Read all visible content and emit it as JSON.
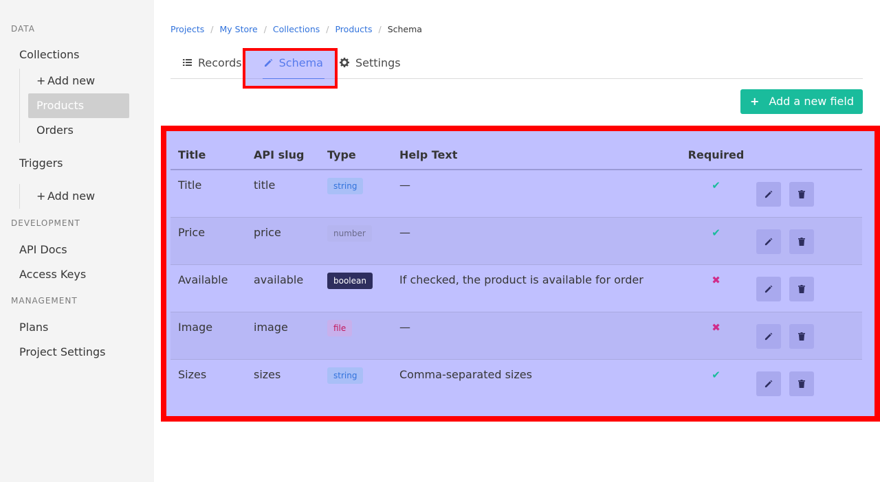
{
  "sidebar": {
    "sections": [
      {
        "label": "DATA"
      },
      {
        "label": "DEVELOPMENT"
      },
      {
        "label": "MANAGEMENT"
      }
    ],
    "collections_label": "Collections",
    "collections_add": "Add new",
    "collections_items": [
      "Products",
      "Orders"
    ],
    "triggers_label": "Triggers",
    "triggers_add": "Add new",
    "dev_items": [
      "API Docs",
      "Access Keys"
    ],
    "mgmt_items": [
      "Plans",
      "Project Settings"
    ]
  },
  "breadcrumb": [
    "Projects",
    "My Store",
    "Collections",
    "Products",
    "Schema"
  ],
  "tabs": [
    {
      "label": "Records",
      "icon": "list-icon"
    },
    {
      "label": "Schema",
      "icon": "pencil-icon",
      "active": true
    },
    {
      "label": "Settings",
      "icon": "gear-icon"
    }
  ],
  "toolbar": {
    "add_field_label": "Add a new field"
  },
  "table": {
    "headers": [
      "Title",
      "API slug",
      "Type",
      "Help Text",
      "Required"
    ],
    "rows": [
      {
        "title": "Title",
        "slug": "title",
        "type": "string",
        "help": "—",
        "required": true
      },
      {
        "title": "Price",
        "slug": "price",
        "type": "number",
        "help": "—",
        "required": true
      },
      {
        "title": "Available",
        "slug": "available",
        "type": "boolean",
        "help": "If checked, the product is available for order",
        "required": false
      },
      {
        "title": "Image",
        "slug": "image",
        "type": "file",
        "help": "—",
        "required": false
      },
      {
        "title": "Sizes",
        "slug": "sizes",
        "type": "string",
        "help": "Comma-separated sizes",
        "required": true
      }
    ]
  },
  "colors": {
    "accent": "#3273dc",
    "primary": "#1abc9c",
    "highlight": "#ff0000"
  }
}
